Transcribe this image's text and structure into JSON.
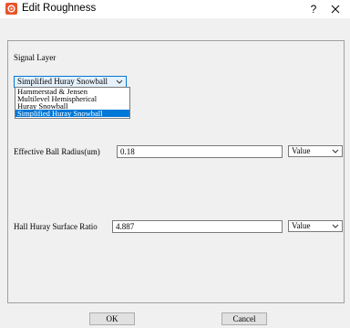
{
  "window": {
    "title": "Edit Roughness",
    "help_label": "?",
    "app_icon": "gear-logo-icon",
    "close_icon": "close-icon"
  },
  "signal_layer": {
    "label": "Signal Layer",
    "selected": "Simplified Huray Snowball",
    "options": [
      "Hammerstad & Jensen",
      "Multilevel Hemispherical",
      "Huray Snowball",
      "Simplified Huray Snowball"
    ],
    "selected_index": 3
  },
  "ball_radius": {
    "label": "Effective Ball Radius(um)",
    "value": "0.18",
    "mode": "Value"
  },
  "surface_ratio": {
    "label": "Hall Huray Surface Ratio",
    "value": "4.887",
    "mode": "Value"
  },
  "buttons": {
    "ok": "OK",
    "cancel": "Cancel"
  },
  "colors": {
    "accent": "#0078d7",
    "app_icon": "#e8542a"
  }
}
